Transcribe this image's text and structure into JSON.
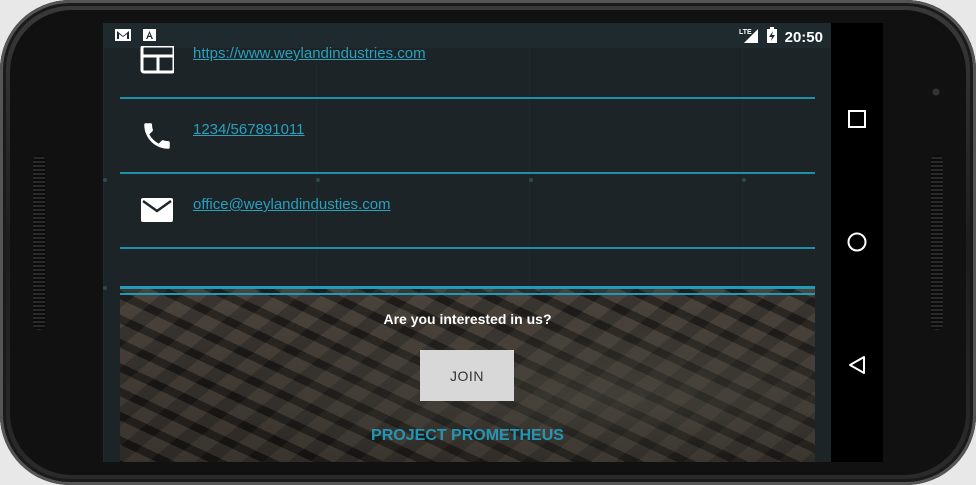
{
  "status_bar": {
    "left_icons": [
      "gmail-icon",
      "a-icon"
    ],
    "network": "LTE",
    "time": "20:50"
  },
  "contacts": [
    {
      "icon": "website-icon",
      "text": "https://www.weylandindustries.com"
    },
    {
      "icon": "phone-icon",
      "text": "1234/567891011"
    },
    {
      "icon": "mail-icon",
      "text": "office@weylandindusties.com"
    }
  ],
  "banner": {
    "question": "Are you interested in us?",
    "join_label": "JOIN",
    "project_name": "PROJECT PROMETHEUS"
  },
  "nav": {
    "buttons": [
      "recents-icon",
      "home-icon",
      "back-icon"
    ]
  },
  "colors": {
    "accent": "#1f9ab8",
    "link": "#2aa0bd",
    "background": "#1c2427"
  }
}
